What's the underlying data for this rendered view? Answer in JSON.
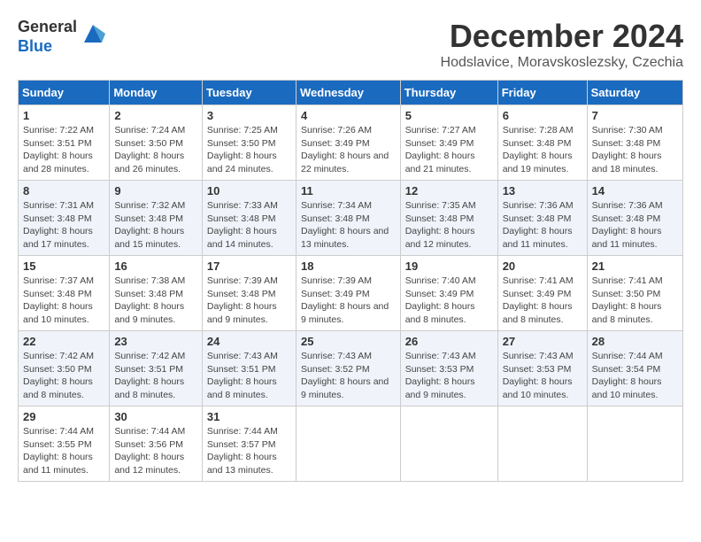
{
  "header": {
    "logo_line1": "General",
    "logo_line2": "Blue",
    "title": "December 2024",
    "location": "Hodslavice, Moravskoslezsky, Czechia"
  },
  "weekdays": [
    "Sunday",
    "Monday",
    "Tuesday",
    "Wednesday",
    "Thursday",
    "Friday",
    "Saturday"
  ],
  "weeks": [
    [
      {
        "day": "1",
        "sunrise": "Sunrise: 7:22 AM",
        "sunset": "Sunset: 3:51 PM",
        "daylight": "Daylight: 8 hours and 28 minutes."
      },
      {
        "day": "2",
        "sunrise": "Sunrise: 7:24 AM",
        "sunset": "Sunset: 3:50 PM",
        "daylight": "Daylight: 8 hours and 26 minutes."
      },
      {
        "day": "3",
        "sunrise": "Sunrise: 7:25 AM",
        "sunset": "Sunset: 3:50 PM",
        "daylight": "Daylight: 8 hours and 24 minutes."
      },
      {
        "day": "4",
        "sunrise": "Sunrise: 7:26 AM",
        "sunset": "Sunset: 3:49 PM",
        "daylight": "Daylight: 8 hours and 22 minutes."
      },
      {
        "day": "5",
        "sunrise": "Sunrise: 7:27 AM",
        "sunset": "Sunset: 3:49 PM",
        "daylight": "Daylight: 8 hours and 21 minutes."
      },
      {
        "day": "6",
        "sunrise": "Sunrise: 7:28 AM",
        "sunset": "Sunset: 3:48 PM",
        "daylight": "Daylight: 8 hours and 19 minutes."
      },
      {
        "day": "7",
        "sunrise": "Sunrise: 7:30 AM",
        "sunset": "Sunset: 3:48 PM",
        "daylight": "Daylight: 8 hours and 18 minutes."
      }
    ],
    [
      {
        "day": "8",
        "sunrise": "Sunrise: 7:31 AM",
        "sunset": "Sunset: 3:48 PM",
        "daylight": "Daylight: 8 hours and 17 minutes."
      },
      {
        "day": "9",
        "sunrise": "Sunrise: 7:32 AM",
        "sunset": "Sunset: 3:48 PM",
        "daylight": "Daylight: 8 hours and 15 minutes."
      },
      {
        "day": "10",
        "sunrise": "Sunrise: 7:33 AM",
        "sunset": "Sunset: 3:48 PM",
        "daylight": "Daylight: 8 hours and 14 minutes."
      },
      {
        "day": "11",
        "sunrise": "Sunrise: 7:34 AM",
        "sunset": "Sunset: 3:48 PM",
        "daylight": "Daylight: 8 hours and 13 minutes."
      },
      {
        "day": "12",
        "sunrise": "Sunrise: 7:35 AM",
        "sunset": "Sunset: 3:48 PM",
        "daylight": "Daylight: 8 hours and 12 minutes."
      },
      {
        "day": "13",
        "sunrise": "Sunrise: 7:36 AM",
        "sunset": "Sunset: 3:48 PM",
        "daylight": "Daylight: 8 hours and 11 minutes."
      },
      {
        "day": "14",
        "sunrise": "Sunrise: 7:36 AM",
        "sunset": "Sunset: 3:48 PM",
        "daylight": "Daylight: 8 hours and 11 minutes."
      }
    ],
    [
      {
        "day": "15",
        "sunrise": "Sunrise: 7:37 AM",
        "sunset": "Sunset: 3:48 PM",
        "daylight": "Daylight: 8 hours and 10 minutes."
      },
      {
        "day": "16",
        "sunrise": "Sunrise: 7:38 AM",
        "sunset": "Sunset: 3:48 PM",
        "daylight": "Daylight: 8 hours and 9 minutes."
      },
      {
        "day": "17",
        "sunrise": "Sunrise: 7:39 AM",
        "sunset": "Sunset: 3:48 PM",
        "daylight": "Daylight: 8 hours and 9 minutes."
      },
      {
        "day": "18",
        "sunrise": "Sunrise: 7:39 AM",
        "sunset": "Sunset: 3:49 PM",
        "daylight": "Daylight: 8 hours and 9 minutes."
      },
      {
        "day": "19",
        "sunrise": "Sunrise: 7:40 AM",
        "sunset": "Sunset: 3:49 PM",
        "daylight": "Daylight: 8 hours and 8 minutes."
      },
      {
        "day": "20",
        "sunrise": "Sunrise: 7:41 AM",
        "sunset": "Sunset: 3:49 PM",
        "daylight": "Daylight: 8 hours and 8 minutes."
      },
      {
        "day": "21",
        "sunrise": "Sunrise: 7:41 AM",
        "sunset": "Sunset: 3:50 PM",
        "daylight": "Daylight: 8 hours and 8 minutes."
      }
    ],
    [
      {
        "day": "22",
        "sunrise": "Sunrise: 7:42 AM",
        "sunset": "Sunset: 3:50 PM",
        "daylight": "Daylight: 8 hours and 8 minutes."
      },
      {
        "day": "23",
        "sunrise": "Sunrise: 7:42 AM",
        "sunset": "Sunset: 3:51 PM",
        "daylight": "Daylight: 8 hours and 8 minutes."
      },
      {
        "day": "24",
        "sunrise": "Sunrise: 7:43 AM",
        "sunset": "Sunset: 3:51 PM",
        "daylight": "Daylight: 8 hours and 8 minutes."
      },
      {
        "day": "25",
        "sunrise": "Sunrise: 7:43 AM",
        "sunset": "Sunset: 3:52 PM",
        "daylight": "Daylight: 8 hours and 9 minutes."
      },
      {
        "day": "26",
        "sunrise": "Sunrise: 7:43 AM",
        "sunset": "Sunset: 3:53 PM",
        "daylight": "Daylight: 8 hours and 9 minutes."
      },
      {
        "day": "27",
        "sunrise": "Sunrise: 7:43 AM",
        "sunset": "Sunset: 3:53 PM",
        "daylight": "Daylight: 8 hours and 10 minutes."
      },
      {
        "day": "28",
        "sunrise": "Sunrise: 7:44 AM",
        "sunset": "Sunset: 3:54 PM",
        "daylight": "Daylight: 8 hours and 10 minutes."
      }
    ],
    [
      {
        "day": "29",
        "sunrise": "Sunrise: 7:44 AM",
        "sunset": "Sunset: 3:55 PM",
        "daylight": "Daylight: 8 hours and 11 minutes."
      },
      {
        "day": "30",
        "sunrise": "Sunrise: 7:44 AM",
        "sunset": "Sunset: 3:56 PM",
        "daylight": "Daylight: 8 hours and 12 minutes."
      },
      {
        "day": "31",
        "sunrise": "Sunrise: 7:44 AM",
        "sunset": "Sunset: 3:57 PM",
        "daylight": "Daylight: 8 hours and 13 minutes."
      },
      null,
      null,
      null,
      null
    ]
  ]
}
